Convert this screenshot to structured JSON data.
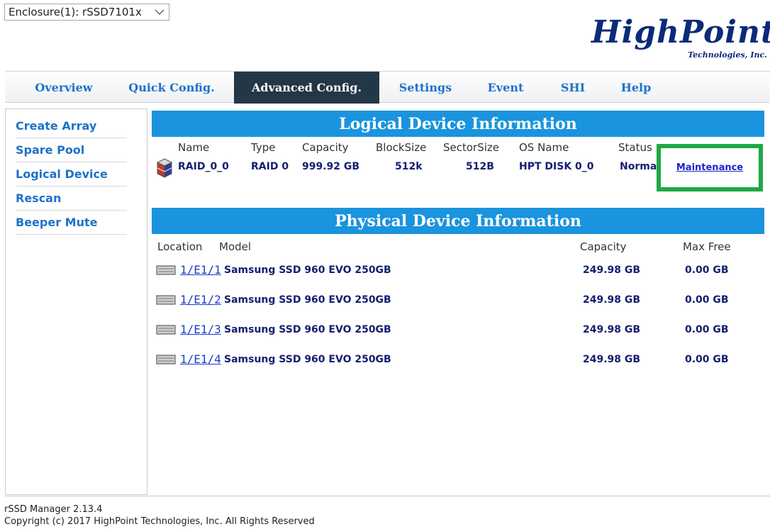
{
  "enclosure_select": {
    "value": "Enclosure(1): rSSD7101x"
  },
  "logo": {
    "brand": "HighPoint",
    "subtitle": "Technologies, Inc."
  },
  "tabs": [
    {
      "label": "Overview"
    },
    {
      "label": "Quick Config."
    },
    {
      "label": "Advanced Config.",
      "active": true
    },
    {
      "label": "Settings"
    },
    {
      "label": "Event"
    },
    {
      "label": "SHI"
    },
    {
      "label": "Help"
    }
  ],
  "sidebar": {
    "items": [
      {
        "label": "Create Array"
      },
      {
        "label": "Spare Pool"
      },
      {
        "label": "Logical Device"
      },
      {
        "label": "Rescan"
      },
      {
        "label": "Beeper Mute"
      }
    ]
  },
  "logical": {
    "title": "Logical Device Information",
    "headers": {
      "name": "Name",
      "type": "Type",
      "capacity": "Capacity",
      "blocksize": "BlockSize",
      "sectorsize": "SectorSize",
      "osname": "OS Name",
      "status": "Status"
    },
    "row": {
      "name": "RAID_0_0",
      "type": "RAID 0",
      "capacity": "999.92 GB",
      "blocksize": "512k",
      "sectorsize": "512B",
      "osname": "HPT DISK 0_0",
      "status": "Norma",
      "maintenance": "Maintenance"
    }
  },
  "physical": {
    "title": "Physical Device Information",
    "headers": {
      "location": "Location",
      "model": "Model",
      "capacity": "Capacity",
      "maxfree": "Max Free"
    },
    "rows": [
      {
        "location": "1/E1/1",
        "model": "Samsung SSD 960 EVO 250GB",
        "capacity": "249.98 GB",
        "maxfree": "0.00 GB"
      },
      {
        "location": "1/E1/2",
        "model": "Samsung SSD 960 EVO 250GB",
        "capacity": "249.98 GB",
        "maxfree": "0.00 GB"
      },
      {
        "location": "1/E1/3",
        "model": "Samsung SSD 960 EVO 250GB",
        "capacity": "249.98 GB",
        "maxfree": "0.00 GB"
      },
      {
        "location": "1/E1/4",
        "model": "Samsung SSD 960 EVO 250GB",
        "capacity": "249.98 GB",
        "maxfree": "0.00 GB"
      }
    ]
  },
  "footer": {
    "version": "rSSD Manager 2.13.4",
    "copyright": "Copyright (c) 2017 HighPoint Technologies, Inc. All Rights Reserved"
  },
  "colors": {
    "tab_active_bg": "#243747",
    "section_header": "#1a94de",
    "link": "#1e72c9",
    "highlight_box": "#1ea846"
  }
}
